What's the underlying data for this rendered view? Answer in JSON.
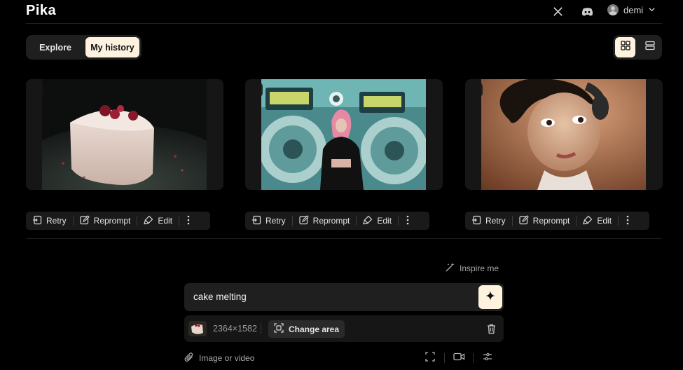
{
  "header": {
    "logo": "Pika",
    "user_name": "demi",
    "x_icon": "x-logo-icon",
    "discord_icon": "discord-icon",
    "chevron_icon": "chevron-down-icon"
  },
  "tabs": [
    {
      "label": "Explore",
      "active": false
    },
    {
      "label": "My history",
      "active": true
    }
  ],
  "view_toggle": [
    {
      "icon": "grid-view-icon",
      "active": true
    },
    {
      "icon": "list-view-icon",
      "active": false
    }
  ],
  "cards": [
    {
      "subject": "cake",
      "media_icon": "image-icon"
    },
    {
      "subject": "girl-boombox",
      "media_icon": "image-icon"
    },
    {
      "subject": "woman-headphones",
      "media_icon": "image-icon"
    }
  ],
  "card_actions": {
    "retry": "Retry",
    "reprompt": "Reprompt",
    "edit": "Edit"
  },
  "prompt": {
    "inspire_label": "Inspire me",
    "text": "cake melting",
    "attachment_resolution": "2364×1582",
    "change_area_label": "Change area",
    "image_or_video_label": "Image or video"
  },
  "colors": {
    "accent": "#fff3e0",
    "background": "#000000",
    "panel": "#1f1f1f"
  }
}
